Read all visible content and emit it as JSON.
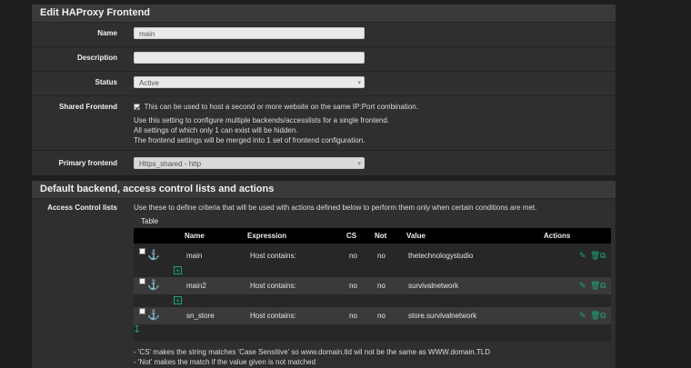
{
  "frontend_panel": {
    "title": "Edit HAProxy Frontend",
    "name": {
      "label": "Name",
      "value": "main"
    },
    "description": {
      "label": "Description",
      "value": ""
    },
    "status": {
      "label": "Status",
      "value": "Active"
    },
    "shared": {
      "label": "Shared Frontend",
      "checkbox_text": "This can be used to host a second or more website on the same IP:Port combination.",
      "help1": "Use this setting to configure multiple backends/accesslists for a single frontend.",
      "help2": "All settings of which only 1 can exist will be hidden.",
      "help3": "The frontend settings will be merged into 1 set of frontend configuration."
    },
    "primary": {
      "label": "Primary frontend",
      "value": "Https_shared - http"
    }
  },
  "acl_panel": {
    "title": "Default backend, access control lists and actions",
    "label": "Access Control lists",
    "intro": "Use these to define criteria that will be used with actions defined below to perform them only when certain conditions are met.",
    "table_title": "Table",
    "columns": {
      "name": "Name",
      "expression": "Expression",
      "cs": "CS",
      "not": "Not",
      "value": "Value",
      "actions": "Actions"
    },
    "rows": [
      {
        "name": "main",
        "expression": "Host contains:",
        "cs": "no",
        "not": "no",
        "value": "thetechnologystudio"
      },
      {
        "name": "main2",
        "expression": "Host contains:",
        "cs": "no",
        "not": "no",
        "value": "survivalnetwork"
      },
      {
        "name": "sn_store",
        "expression": "Host contains:",
        "cs": "no",
        "not": "no",
        "value": "store.survivalnetwork"
      }
    ],
    "note1": "- 'CS' makes the string matches 'Case Sensitive' so www.domain.tld wil not be the same as WWW.domain.TLD",
    "note2": "- 'Not' makes the match if the value given is not matched"
  },
  "colors": {
    "accent": "#1fa37a",
    "panel": "#2f2f2f",
    "header": "#3a3a3a",
    "table_head": "#000000"
  },
  "icons": [
    "anchor-icon",
    "pencil-icon",
    "trash-icon",
    "copy-icon",
    "plus-icon",
    "down-arrow-icon"
  ]
}
